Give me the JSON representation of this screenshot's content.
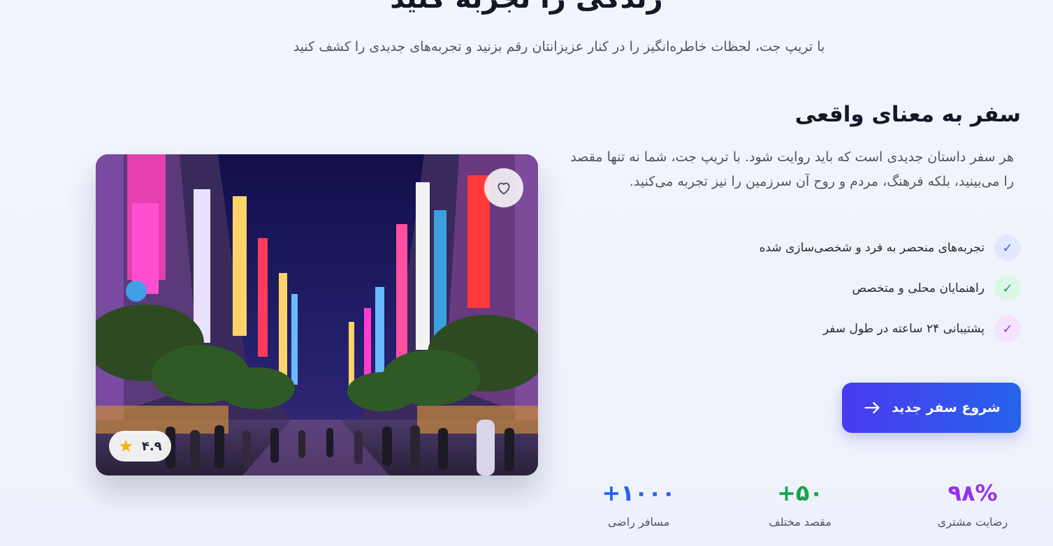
{
  "hero": {
    "title": "زندگی را تجربه کنید",
    "subtitle": "با تریپ جت، لحظات خاطره‌انگیز را در کنار عزیزانتان رقم بزنید و تجربه‌های جدیدی را کشف کنید"
  },
  "section": {
    "title": "سفر به معنای واقعی",
    "description": "هر سفر داستان جدیدی است که باید روایت شود. با تریپ جت، شما نه تنها مقصد را می‌بینید، بلکه فرهنگ، مردم و روح آن سرزمین را نیز تجربه می‌کنید."
  },
  "features": [
    {
      "label": "تجربه‌های منحصر به فرد و شخصی‌سازی شده",
      "icon": "check-icon",
      "color": "#2563eb"
    },
    {
      "label": "راهنمایان محلی و متخصص",
      "icon": "check-icon",
      "color": "#16a34a"
    },
    {
      "label": "پشتیبانی ۲۴ ساعته در طول سفر",
      "icon": "check-icon",
      "color": "#9333ea"
    }
  ],
  "cta": {
    "label": "شروع سفر جدید",
    "icon": "arrow-right-icon"
  },
  "stats": [
    {
      "value": "۹۸%",
      "label": "رضایت مشتری",
      "color": "#9333ea"
    },
    {
      "value": "۵۰+",
      "label": "مقصد مختلف",
      "color": "#16a34a"
    },
    {
      "value": "۱۰۰۰+",
      "label": "مسافر راضی",
      "color": "#2563eb"
    }
  ],
  "image": {
    "rating": "۴.۹",
    "rating_icon": "star-icon",
    "favorite_icon": "heart-icon"
  }
}
